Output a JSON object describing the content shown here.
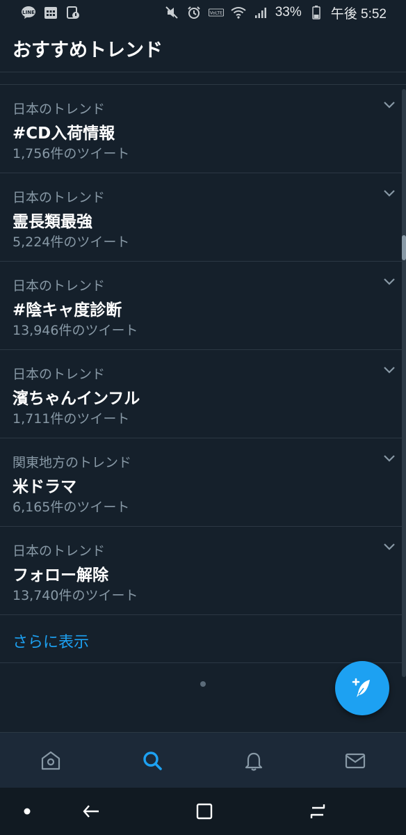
{
  "status_bar": {
    "battery_percent": "33%",
    "time": "午後 5:52",
    "icons": [
      "line-app-icon",
      "calendar-grid-icon",
      "sim-lock-icon",
      "mute-icon",
      "alarm-icon",
      "volte-icon",
      "wifi-icon",
      "signal-icon",
      "battery-icon"
    ]
  },
  "header": {
    "title": "おすすめトレンド"
  },
  "trends": [
    {
      "context": "日本のトレンド",
      "name": "#CD入荷情報",
      "count": "1,756件のツイート"
    },
    {
      "context": "日本のトレンド",
      "name": "霊長類最強",
      "count": "5,224件のツイート"
    },
    {
      "context": "日本のトレンド",
      "name": "#陰キャ度診断",
      "count": "13,946件のツイート"
    },
    {
      "context": "日本のトレンド",
      "name": "濱ちゃんインフル",
      "count": "1,711件のツイート"
    },
    {
      "context": "関東地方のトレンド",
      "name": "米ドラマ",
      "count": "6,165件のツイート"
    },
    {
      "context": "日本のトレンド",
      "name": "フォロー解除",
      "count": "13,740件のツイート"
    }
  ],
  "show_more": {
    "label": "さらに表示"
  },
  "fab": {
    "icon": "compose-tweet-icon"
  },
  "tab_bar": {
    "tabs": [
      {
        "id": "home",
        "icon": "home-icon",
        "active": false
      },
      {
        "id": "search",
        "icon": "search-icon",
        "active": true
      },
      {
        "id": "notifications",
        "icon": "bell-icon",
        "active": false
      },
      {
        "id": "messages",
        "icon": "mail-icon",
        "active": false
      }
    ]
  },
  "nav_bar": {
    "items": [
      "dot-icon",
      "back-icon",
      "recents-icon",
      "switch-apps-icon"
    ]
  },
  "colors": {
    "background": "#15202b",
    "accent": "#1da1f2",
    "secondary_text": "#8899a6",
    "divider": "#2c3844"
  }
}
